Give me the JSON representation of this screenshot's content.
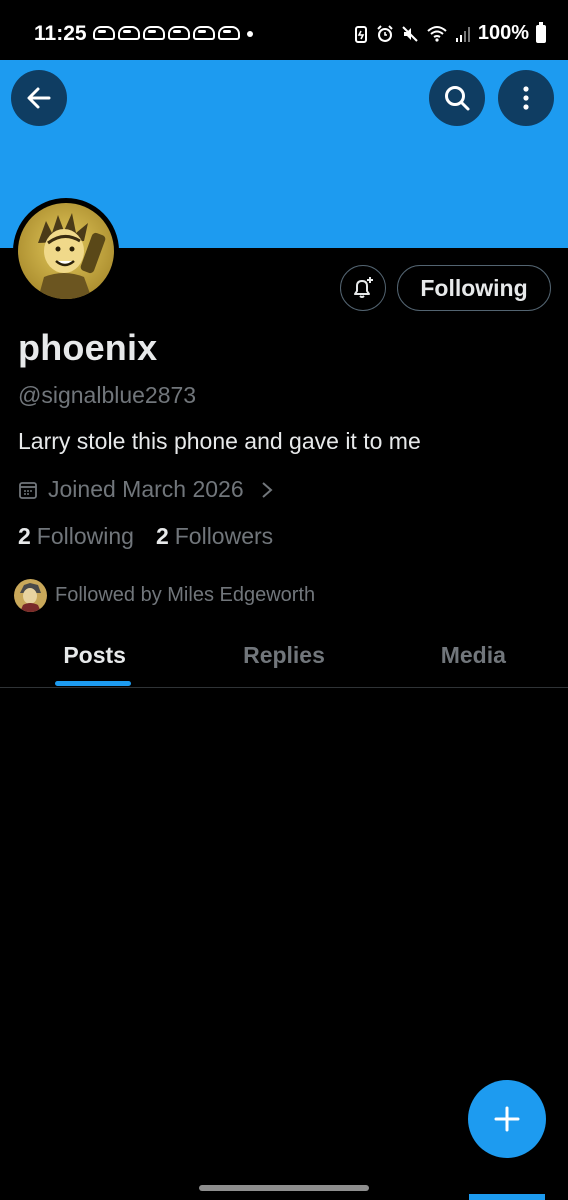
{
  "status_bar": {
    "time": "11:25",
    "battery_text": "100%",
    "notification_icon_count": 6
  },
  "colors": {
    "banner": "#1d9bf0",
    "accent": "#1d9bf0",
    "background": "#000000",
    "muted_text": "#71767b"
  },
  "header": {
    "back_icon": "arrow-left-icon",
    "search_icon": "search-icon",
    "more_icon": "more-vertical-icon"
  },
  "profile": {
    "display_name": "phoenix",
    "handle": "@signalblue2873",
    "bio": "Larry stole this phone and gave it to me",
    "joined": "Joined March 2026",
    "following_count": "2",
    "following_label": "Following",
    "followers_count": "2",
    "followers_label": "Followers",
    "followed_by": "Followed by Miles Edgeworth"
  },
  "actions": {
    "notify_icon": "bell-plus-icon",
    "follow_button_label": "Following"
  },
  "tabs": [
    {
      "label": "Posts",
      "active": true
    },
    {
      "label": "Replies",
      "active": false
    },
    {
      "label": "Media",
      "active": false
    }
  ],
  "fab": {
    "icon": "plus-icon"
  }
}
